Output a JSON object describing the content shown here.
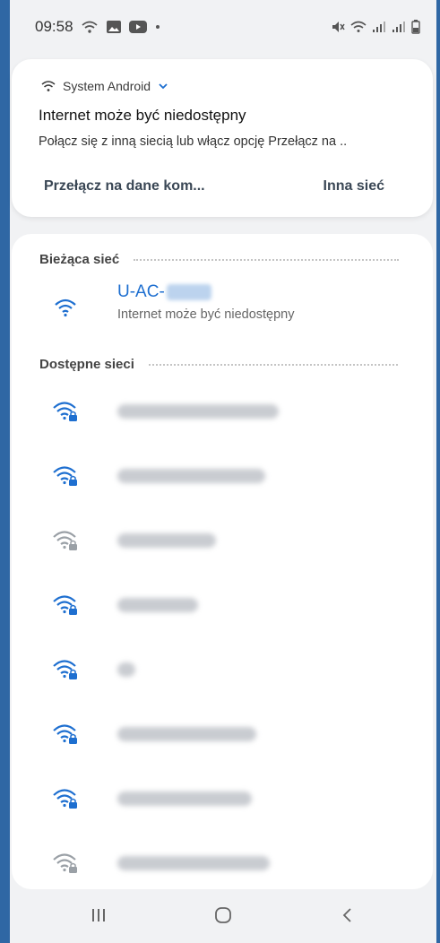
{
  "status_bar": {
    "time": "09:58",
    "left_icons": [
      "wifi-notification-icon",
      "gallery-icon",
      "youtube-icon",
      "dot-icon"
    ],
    "right_icons": [
      "mute-icon",
      "wifi-icon",
      "signal-icon",
      "signal-icon",
      "battery-icon"
    ]
  },
  "notification": {
    "source": "System Android",
    "title": "Internet może być niedostępny",
    "body": "Połącz się z inną siecią lub włącz opcję Przełącz na ..",
    "actions": {
      "switch_label": "Przełącz na dane kom...",
      "other_label": "Inna sieć"
    }
  },
  "wifi": {
    "current_section_label": "Bieżąca sieć",
    "current_network": {
      "name": "U-AC-",
      "status": "Internet może być niedostępny",
      "icon": "wifi-icon",
      "color": "#1e6fd0"
    },
    "available_section_label": "Dostępne sieci",
    "available_networks": [
      {
        "name": "",
        "icon": "wifi-lock-icon",
        "signal": "strong",
        "color": "#1e6fd0"
      },
      {
        "name": "",
        "icon": "wifi-lock-icon",
        "signal": "strong",
        "color": "#1e6fd0"
      },
      {
        "name": "",
        "icon": "wifi-lock-icon",
        "signal": "weak",
        "color": "#9aa0a6"
      },
      {
        "name": "",
        "icon": "wifi-lock-icon",
        "signal": "strong",
        "color": "#1e6fd0"
      },
      {
        "name": "",
        "icon": "wifi-lock-icon",
        "signal": "strong",
        "color": "#1e6fd0"
      },
      {
        "name": "",
        "icon": "wifi-lock-icon",
        "signal": "strong",
        "color": "#1e6fd0"
      },
      {
        "name": "",
        "icon": "wifi-lock-icon",
        "signal": "strong",
        "color": "#1e6fd0"
      },
      {
        "name": "",
        "icon": "wifi-lock-icon",
        "signal": "weak",
        "color": "#9aa0a6"
      }
    ]
  },
  "navigation": {
    "recent_icon": "recent-apps-icon",
    "home_icon": "home-icon",
    "back_icon": "back-icon"
  }
}
